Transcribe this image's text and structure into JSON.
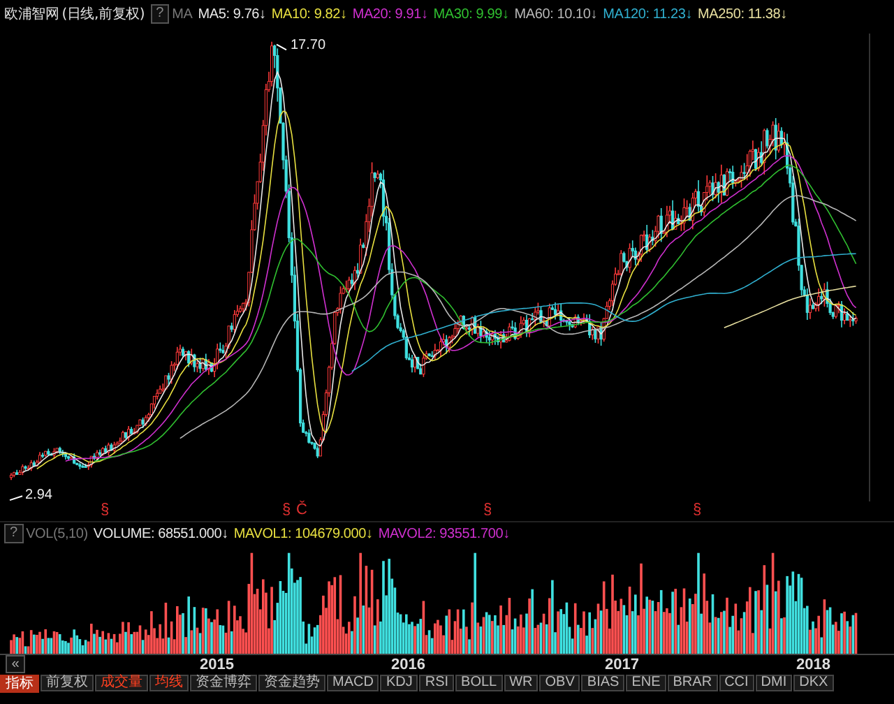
{
  "title": "欧浦智网",
  "subtitle": "(日线,前复权)",
  "help_button": "?",
  "ma_label": "MA",
  "ma_lines": [
    {
      "label": "MA5: 9.76",
      "arrow": "↓",
      "color": "#e8e8e8"
    },
    {
      "label": "MA10: 9.82",
      "arrow": "↓",
      "color": "#e8e040"
    },
    {
      "label": "MA20: 9.91",
      "arrow": "↓",
      "color": "#d030d0"
    },
    {
      "label": "MA30: 9.99",
      "arrow": "↓",
      "color": "#30c030"
    },
    {
      "label": "MA60: 10.10",
      "arrow": "↓",
      "color": "#b8b8b8"
    },
    {
      "label": "MA120: 11.23",
      "arrow": "↓",
      "color": "#30b0d0"
    },
    {
      "label": "MA250: 11.38",
      "arrow": "↓",
      "color": "#e8e0a0"
    }
  ],
  "price_chart": {
    "high_label": "17.70",
    "low_label": "2.94"
  },
  "event_markers": [
    {
      "text": "§"
    },
    {
      "text": "§"
    },
    {
      "text": "Č"
    },
    {
      "text": "§"
    },
    {
      "text": "§"
    }
  ],
  "volume_legend": {
    "help_button": "?",
    "label": "VOL(5,10)",
    "items": [
      {
        "label": "VOLUME: 68551.000",
        "arrow": "↓",
        "color": "#e8e8e8"
      },
      {
        "label": "MAVOL1: 104679.000",
        "arrow": "↓",
        "color": "#e8e040"
      },
      {
        "label": "MAVOL2: 93551.700",
        "arrow": "↓",
        "color": "#d030d0"
      }
    ]
  },
  "x_axis": {
    "collapse_button": "«",
    "years": [
      "2015",
      "2016",
      "2017",
      "2018"
    ]
  },
  "indicator_label": "指标",
  "tabs": [
    {
      "label": "前复权",
      "selected": false
    },
    {
      "label": "成交量",
      "selected": true
    },
    {
      "label": "均线",
      "selected": true
    },
    {
      "label": "资金博弈",
      "selected": false
    },
    {
      "label": "资金趋势",
      "selected": false
    },
    {
      "label": "MACD",
      "selected": false
    },
    {
      "label": "KDJ",
      "selected": false
    },
    {
      "label": "RSI",
      "selected": false
    },
    {
      "label": "BOLL",
      "selected": false
    },
    {
      "label": "WR",
      "selected": false
    },
    {
      "label": "OBV",
      "selected": false
    },
    {
      "label": "BIAS",
      "selected": false
    },
    {
      "label": "ENE",
      "selected": false
    },
    {
      "label": "BRAR",
      "selected": false
    },
    {
      "label": "CCI",
      "selected": false
    },
    {
      "label": "DMI",
      "selected": false
    },
    {
      "label": "DKX",
      "selected": false
    }
  ]
}
